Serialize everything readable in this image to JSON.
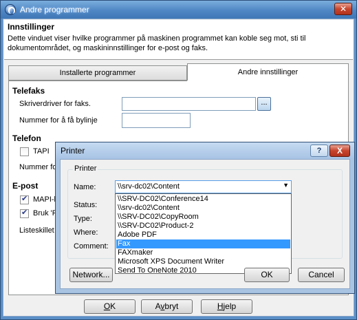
{
  "window": {
    "title": "Andre programmer"
  },
  "header": {
    "title": "Innstillinger",
    "description": "Dette vinduet viser hvilke programmer på maskinen programmet kan koble seg mot, sti til dokumentområdet, og maskininnstillinger for e-post og faks."
  },
  "tabs": [
    {
      "label": "Installerte programmer",
      "active": false
    },
    {
      "label": "Andre innstillinger",
      "active": true
    }
  ],
  "telefaks": {
    "heading": "Telefaks",
    "driver_label": "Skriverdriver for faks.",
    "driver_value": "",
    "browse_label": "...",
    "number_label": "Nummer for å få bylinje",
    "number_value": ""
  },
  "telefon": {
    "heading": "Telefon",
    "tapi_label": "TAPI",
    "tapi_checked": false,
    "number_label": "Nummer for"
  },
  "epost": {
    "heading": "E-post",
    "mapi_label": "MAPI-ba",
    "mapi_checked": true,
    "bruk_label": "Bruk 'Ri",
    "bruk_checked": true,
    "separator_label": "Listeskillet"
  },
  "footer": {
    "ok": {
      "underlined": "O",
      "rest": "K"
    },
    "cancel": {
      "prefix": "A",
      "underlined": "v",
      "rest": "bryt"
    },
    "help": {
      "underlined": "H",
      "rest": "jelp"
    }
  },
  "printer_dialog": {
    "title": "Printer",
    "help_label": "?",
    "close_label": "X",
    "group_label": "Printer",
    "name_label": "Name:",
    "name_value": "\\\\srv-dc02\\Content",
    "status_label": "Status:",
    "type_label": "Type:",
    "where_label": "Where:",
    "comment_label": "Comment:",
    "options": [
      "\\\\SRV-DC02\\Conference14",
      "\\\\srv-dc02\\Content",
      "\\\\SRV-DC02\\CopyRoom",
      "\\\\SRV-DC02\\Product-2",
      "Adobe PDF",
      "Fax",
      "FAXmaker",
      "Microsoft XPS Document Writer",
      "Send To OneNote 2010"
    ],
    "selected_option": "Fax",
    "network_button": "Network...",
    "ok_button": "OK",
    "cancel_button": "Cancel"
  },
  "colors": {
    "accent": "#3399ff",
    "title_bar": "#5a8fc8",
    "close": "#c7452d"
  }
}
